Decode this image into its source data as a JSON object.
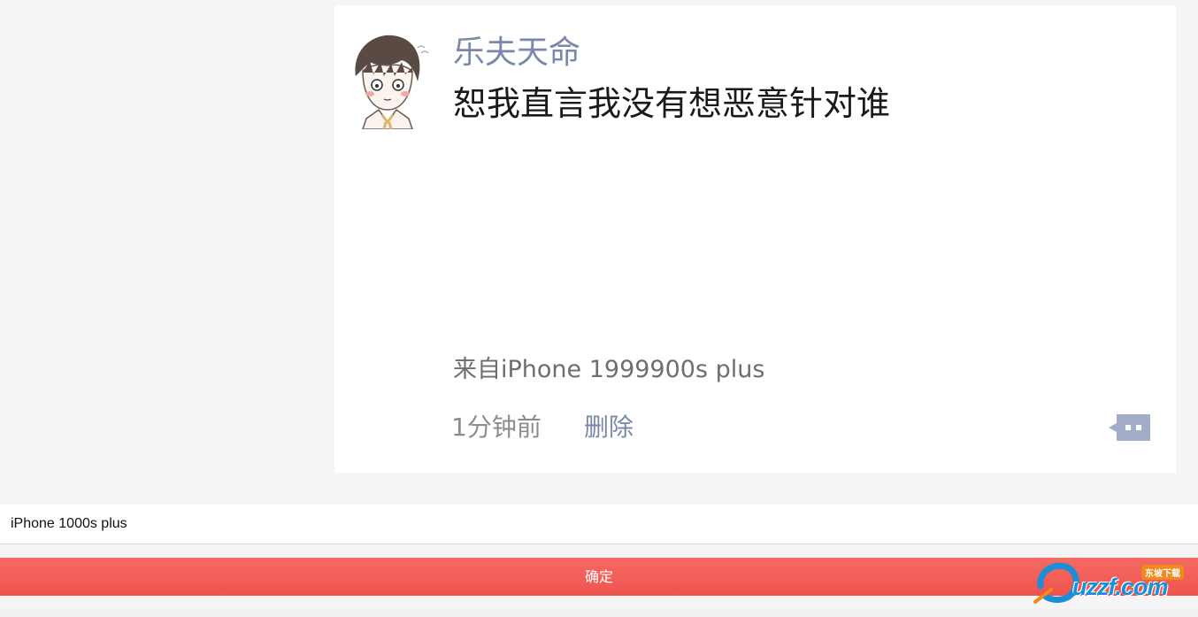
{
  "preview": {
    "username": "乐夫天命",
    "post_text": "恕我直言我没有想恶意针对谁",
    "source": "来自iPhone 1999900s plus",
    "time": "1分钟前",
    "delete_label": "删除",
    "icons": {
      "avatar": "anime-boy-avatar",
      "comment": "comment-bubble-icon"
    },
    "colors": {
      "username": "#7b87ab",
      "link": "#7b87ab"
    }
  },
  "device_input": {
    "value": "iPhone 1000s plus"
  },
  "confirm": {
    "label": "确定",
    "color": "#ef534d"
  },
  "watermark": {
    "logo_text": "uzzf.com",
    "tag": "东坡下载"
  }
}
